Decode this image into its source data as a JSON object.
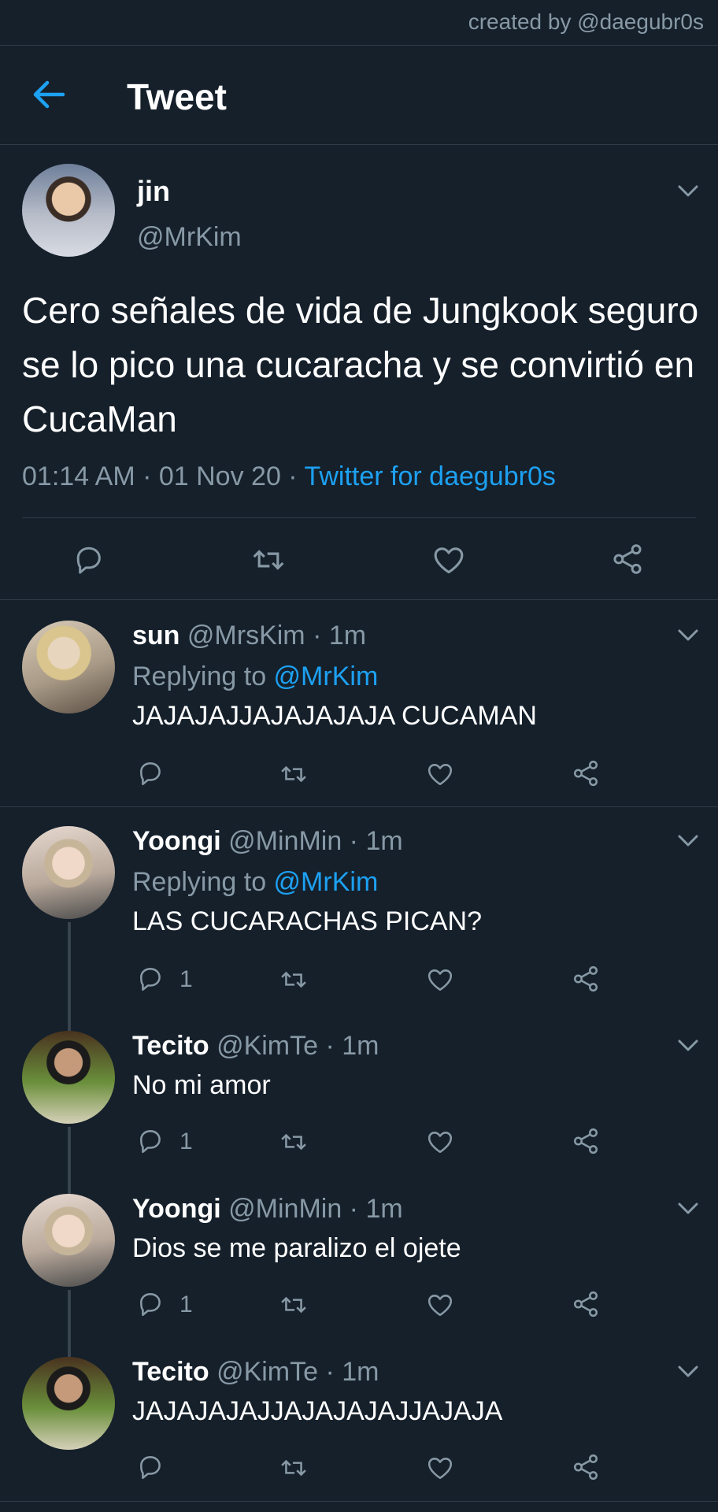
{
  "watermark": "created by @daegubr0s",
  "header": {
    "title": "Tweet"
  },
  "main_tweet": {
    "name": "jin",
    "handle": "@MrKim",
    "text": "Cero señales de vida de Jungkook seguro se lo pico una cucaracha y se convirtió en CucaMan",
    "time": "01:14 AM · 01 Nov 20 · ",
    "source": "Twitter for daegubr0s"
  },
  "replies": [
    {
      "name": "sun",
      "handle": "@MrsKim",
      "time": " · 1m",
      "replying_label": "Replying to ",
      "replying_to": "@MrKim",
      "text": "JAJAJAJJAJAJAJAJA CUCAMAN",
      "reply_count": ""
    },
    {
      "name": "Yoongi",
      "handle": "@MinMin",
      "time": " · 1m",
      "replying_label": "Replying to ",
      "replying_to": "@MrKim",
      "text": "LAS CUCARACHAS PICAN?",
      "reply_count": "1"
    },
    {
      "name": "Tecito",
      "handle": "@KimTe",
      "time": " · 1m",
      "text": "No mi amor",
      "reply_count": "1"
    },
    {
      "name": "Yoongi",
      "handle": "@MinMin",
      "time": " · 1m",
      "text": "Dios se me paralizo el ojete",
      "reply_count": "1"
    },
    {
      "name": "Tecito",
      "handle": "@KimTe",
      "time": " · 1m",
      "text": "JAJAJAJAJJAJAJAJAJJAJAJA",
      "reply_count": ""
    }
  ],
  "colors": {
    "background": "#15202b",
    "accent": "#1da1f2",
    "secondary_text": "#8899a6",
    "border": "#2f3b47"
  },
  "icons": [
    "back-arrow-icon",
    "chevron-down-icon",
    "reply-icon",
    "retweet-icon",
    "like-icon",
    "share-icon"
  ]
}
